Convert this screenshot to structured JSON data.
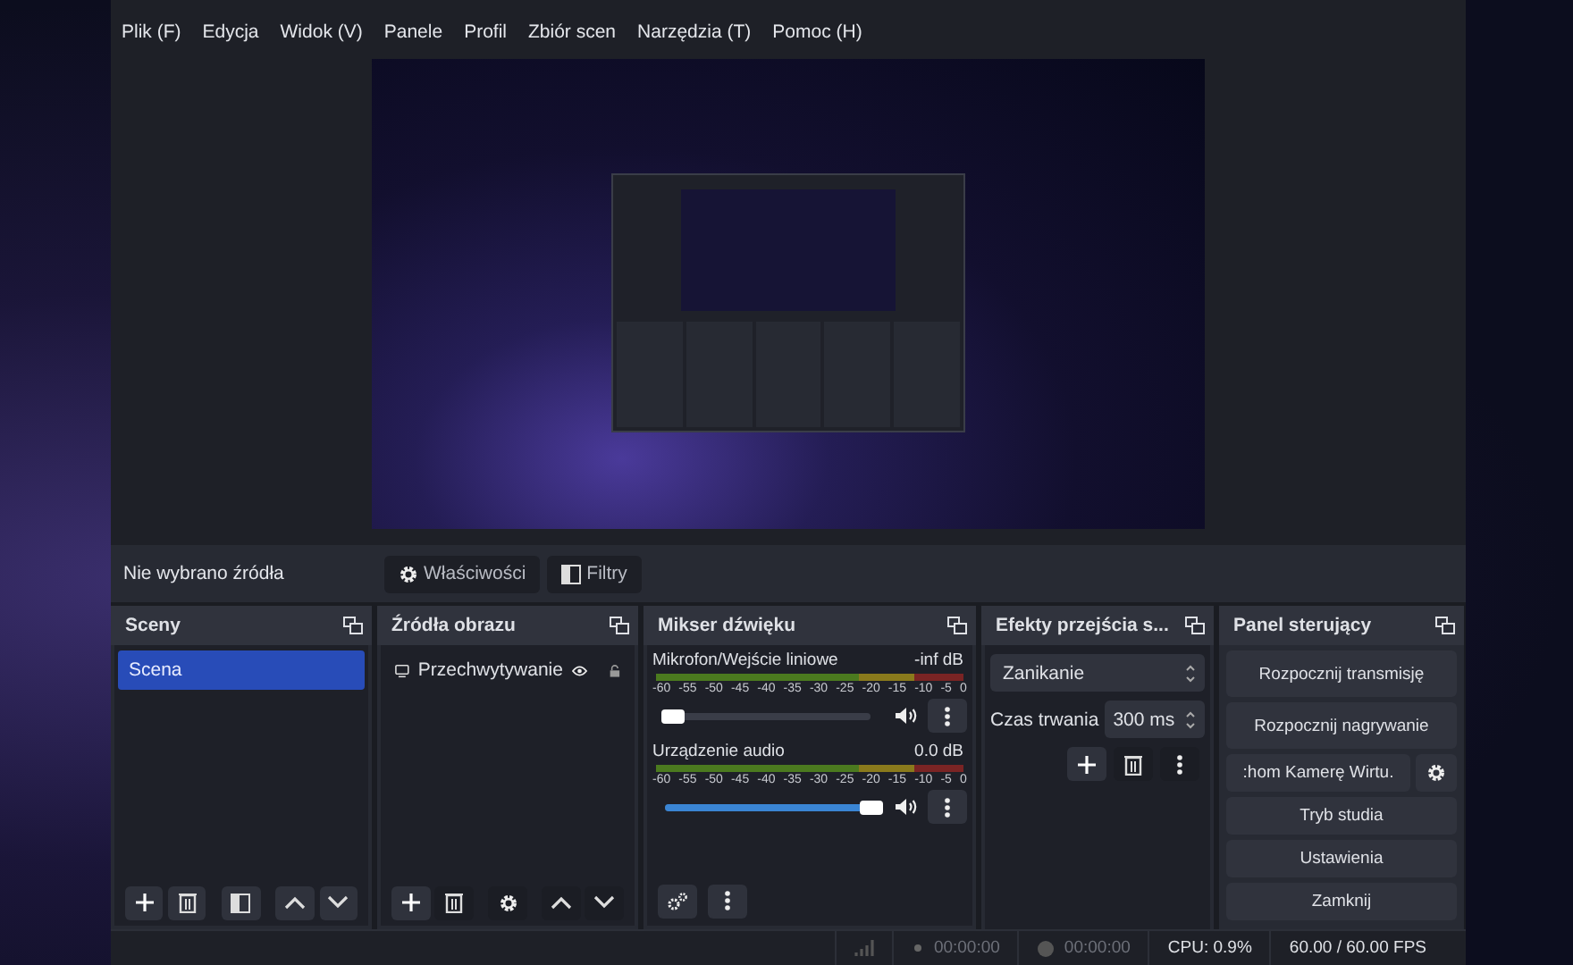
{
  "menu": [
    "Plik (F)",
    "Edycja",
    "Widok (V)",
    "Panele",
    "Profil",
    "Zbiór scen",
    "Narzędzia (T)",
    "Pomoc (H)"
  ],
  "source_bar": {
    "label": "Nie wybrano źródła",
    "buttons": [
      {
        "label": "Właściwości",
        "kind": "gear"
      },
      {
        "label": "Filtry",
        "kind": "filter"
      }
    ]
  },
  "scenes": {
    "title": "Sceny",
    "items": [
      {
        "label": "Scena",
        "selected": true
      }
    ]
  },
  "sources": {
    "title": "Źródła obrazu",
    "items": [
      {
        "label": "Przechwytywanie",
        "selected": false
      }
    ]
  },
  "mixer": {
    "title": "Mikser dźwięku",
    "channels": [
      {
        "name": "Mikrofon/Wejście liniowe",
        "reading": "-inf dB",
        "level": 0.04,
        "scale": [
          "-60",
          "-55",
          "-50",
          "-45",
          "-40",
          "-35",
          "-30",
          "-25",
          "-20",
          "-15",
          "-10",
          "-5",
          "0"
        ]
      },
      {
        "name": "Urządzenie audio",
        "reading": "0.0 dB",
        "level": 1.0,
        "scale": [
          "-60",
          "-55",
          "-50",
          "-45",
          "-40",
          "-35",
          "-30",
          "-25",
          "-20",
          "-15",
          "-10",
          "-5",
          "0"
        ]
      }
    ]
  },
  "transitions": {
    "title": "Efekty przejścia s...",
    "transition": "Zanikanie",
    "duration_label": "Czas trwania",
    "duration": "300 ms"
  },
  "controls": {
    "title": "Panel sterujący",
    "buttons": [
      {
        "label": "Rozpocznij transmisję",
        "kind": "plain"
      },
      {
        "label": "Rozpocznij nagrywanie",
        "kind": "plain"
      },
      {
        "label": ":hom Kamerę Wirtu.",
        "kind": "with-settings"
      },
      {
        "label": "Tryb studia",
        "kind": "plain"
      },
      {
        "label": "Ustawienia",
        "kind": "plain"
      },
      {
        "label": "Zamknij",
        "kind": "plain"
      }
    ]
  },
  "status_bar": {
    "stream_time": "00:00:00",
    "record_time": "00:00:00",
    "cpu": "CPU: 0.9%",
    "fps": "60.00 / 60.00 FPS"
  }
}
